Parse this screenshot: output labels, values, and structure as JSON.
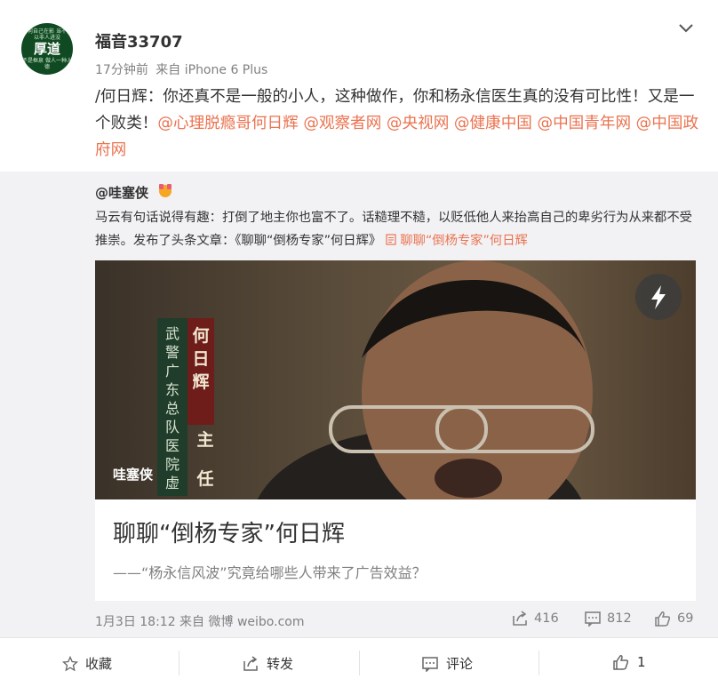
{
  "post": {
    "username": "福音33707",
    "time": "17分钟前",
    "source": "来自 iPhone 6 Plus",
    "avatar": {
      "small_top": "事何自己在影\n当不要以非人进没",
      "big": "厚道",
      "small_bottom": "不是框泉\n做人一种人德"
    },
    "text_prefix": "/何日辉：你还真不是一般的小人，这种做作，你和杨永信医生真的没有可比性！又是一个败类！",
    "mentions": [
      "@心理脱瘾哥何日辉",
      "@观察者网",
      "@央视网",
      "@健康中国",
      "@中国青年网",
      "@中国政府网"
    ]
  },
  "repost": {
    "username": "@哇塞侠",
    "text": "马云有句话说得有趣：打倒了地主你也富不了。话糙理不糙，以贬低他人来抬高自己的卑劣行为从来都不受推崇。发布了头条文章：《聊聊“倒杨专家”何日辉》",
    "link_text": "聊聊“倒杨专家”何日辉",
    "card": {
      "image_label": "哇塞侠",
      "caption_red": [
        "何",
        "日",
        "辉",
        "主",
        "任"
      ],
      "caption_green": [
        "武",
        "警",
        "广",
        "东",
        "总",
        "队",
        "医",
        "院",
        "虚"
      ],
      "title": "聊聊“倒杨专家”何日辉",
      "subtitle": "——“杨永信风波”究竟给哪些人带来了广告效益？"
    },
    "time": "1月3日 18:12 来自 微博 weibo.com",
    "reposts": "416",
    "comments": "812",
    "likes": "69"
  },
  "actions": {
    "favorite": "收藏",
    "repost": "转发",
    "comment": "评论",
    "like": "1"
  },
  "colors": {
    "mention": "#eb7350",
    "meta": "#808080",
    "repost_bg": "#f2f2f5"
  }
}
